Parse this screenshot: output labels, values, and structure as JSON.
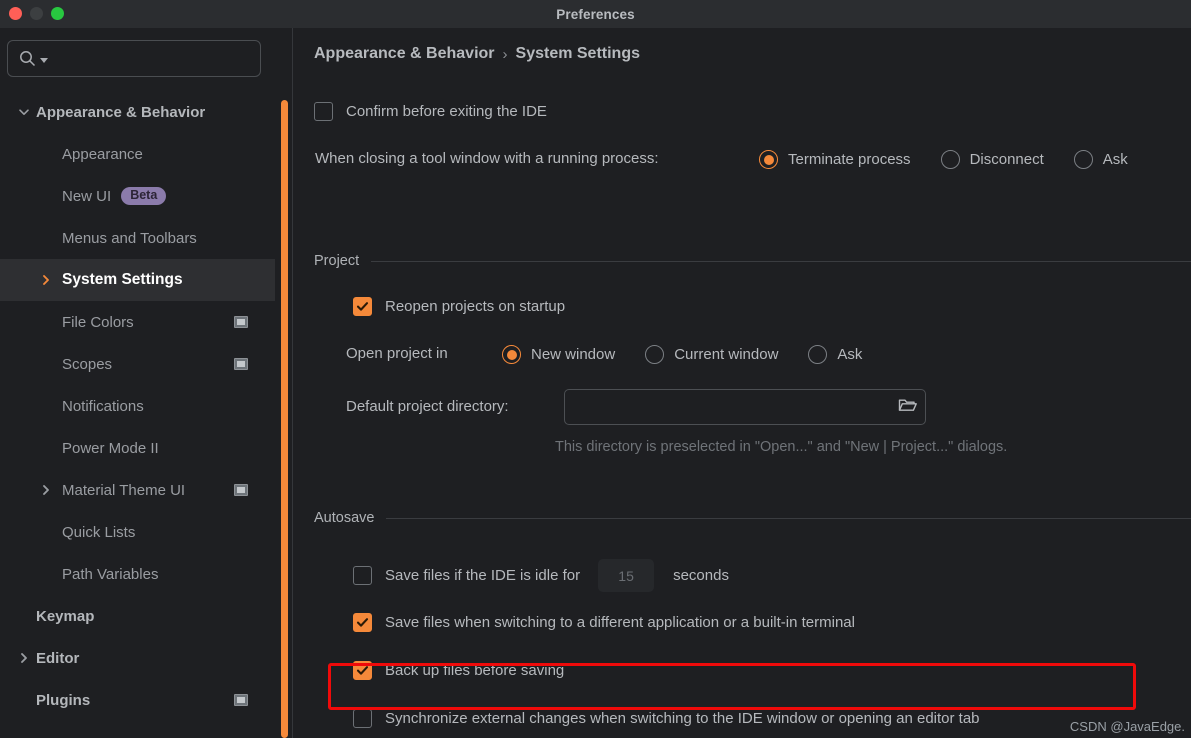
{
  "window": {
    "title": "Preferences",
    "controls": [
      "close-button",
      "minimize-button",
      "maximize-button"
    ]
  },
  "sidebar": {
    "search": {
      "value": "",
      "placeholder": "",
      "icon": "search-icon"
    },
    "items": [
      {
        "label": "Appearance & Behavior",
        "level": 0,
        "expanded": true,
        "chevron": "chevron-down-icon",
        "selected": false,
        "plugin_icon": false
      },
      {
        "label": "Appearance",
        "level": 1,
        "chevron": null,
        "selected": false,
        "plugin_icon": false
      },
      {
        "label": "New UI",
        "level": 1,
        "chevron": null,
        "selected": false,
        "plugin_icon": false,
        "badge": "Beta"
      },
      {
        "label": "Menus and Toolbars",
        "level": 1,
        "chevron": null,
        "selected": false,
        "plugin_icon": false
      },
      {
        "label": "System Settings",
        "level": 1,
        "chevron": "chevron-right-icon",
        "selected": true,
        "plugin_icon": false
      },
      {
        "label": "File Colors",
        "level": 1,
        "chevron": null,
        "selected": false,
        "plugin_icon": true
      },
      {
        "label": "Scopes",
        "level": 1,
        "chevron": null,
        "selected": false,
        "plugin_icon": true
      },
      {
        "label": "Notifications",
        "level": 1,
        "chevron": null,
        "selected": false,
        "plugin_icon": false
      },
      {
        "label": "Power Mode II",
        "level": 1,
        "chevron": null,
        "selected": false,
        "plugin_icon": false
      },
      {
        "label": "Material Theme UI",
        "level": 1,
        "chevron": "chevron-right-icon",
        "selected": false,
        "plugin_icon": true
      },
      {
        "label": "Quick Lists",
        "level": 1,
        "chevron": null,
        "selected": false,
        "plugin_icon": false
      },
      {
        "label": "Path Variables",
        "level": 1,
        "chevron": null,
        "selected": false,
        "plugin_icon": false
      },
      {
        "label": "Keymap",
        "level": 0,
        "chevron": null,
        "selected": false,
        "plugin_icon": false
      },
      {
        "label": "Editor",
        "level": 0,
        "chevron": "chevron-right-icon",
        "selected": false,
        "plugin_icon": false
      },
      {
        "label": "Plugins",
        "level": 0,
        "chevron": null,
        "selected": false,
        "plugin_icon": true
      }
    ]
  },
  "breadcrumb": {
    "parent": "Appearance & Behavior",
    "separator": "›",
    "current": "System Settings"
  },
  "main": {
    "confirm_exit": {
      "label": "Confirm before exiting the IDE",
      "checked": false
    },
    "closing_tool_window": {
      "label": "When closing a tool window with a running process:",
      "options": [
        {
          "label": "Terminate process",
          "selected": true
        },
        {
          "label": "Disconnect",
          "selected": false
        },
        {
          "label": "Ask",
          "selected": false
        }
      ]
    },
    "project": {
      "title": "Project",
      "reopen": {
        "label": "Reopen projects on startup",
        "checked": true
      },
      "open_project_in": {
        "label": "Open project in",
        "options": [
          {
            "label": "New window",
            "selected": true
          },
          {
            "label": "Current window",
            "selected": false
          },
          {
            "label": "Ask",
            "selected": false
          }
        ]
      },
      "default_dir": {
        "label": "Default project directory:",
        "value": "",
        "placeholder": "",
        "browse_icon": "folder-icon"
      },
      "hint": "This directory is preselected in \"Open...\" and \"New | Project...\" dialogs."
    },
    "autosave": {
      "title": "Autosave",
      "idle": {
        "label_before": "Save files if the IDE is idle for",
        "seconds_value": "15",
        "label_after": "seconds",
        "checked": false
      },
      "switch_app": {
        "label": "Save files when switching to a different application or a built-in terminal",
        "checked": true
      },
      "backup": {
        "label": "Back up files before saving",
        "checked": true
      },
      "sync_external": {
        "label": "Synchronize external changes when switching to the IDE window or opening an editor tab",
        "checked": false,
        "highlighted": true
      }
    }
  },
  "watermark": {
    "text": "CSDN @JavaEdge."
  },
  "colors": {
    "accent": "#f5893a",
    "background": "#1e1f22",
    "titlebar": "#2b2d30",
    "highlight": "#f00a0a",
    "badge": "#8b7bab"
  }
}
